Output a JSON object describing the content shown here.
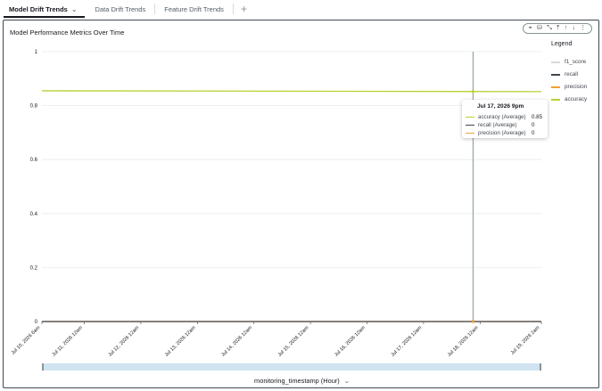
{
  "tabs": [
    {
      "label": "Model Drift Trends",
      "active": true
    },
    {
      "label": "Data Drift Trends",
      "active": false
    },
    {
      "label": "Feature Drift Trends",
      "active": false
    }
  ],
  "tab_add_label": "+",
  "visual": {
    "title": "Model Performance Metrics Over Time",
    "toolbar_icons": [
      "focus-icon",
      "drill-icon",
      "collapse-icon",
      "sort-top-icon",
      "sort-up-icon",
      "sort-down-icon",
      "more-icon"
    ],
    "toolbar_glyphs": [
      "⌖",
      "⛁",
      "⤡",
      "⤒",
      "↑",
      "↓",
      "⋮"
    ],
    "x_field_label": "monitoring_timestamp (Hour)"
  },
  "legend": {
    "title": "Legend",
    "items": [
      {
        "label": "f1_score",
        "color": "#d5dbdb"
      },
      {
        "label": "recall",
        "color": "#414750"
      },
      {
        "label": "precision",
        "color": "#f0a037"
      },
      {
        "label": "accuracy",
        "color": "#b7d132"
      }
    ]
  },
  "tooltip": {
    "header": "Jul 17, 2026 9pm",
    "rows": [
      {
        "name": "accuracy (Average)",
        "value": "0.85",
        "color": "#b7d132"
      },
      {
        "name": "recall (Average)",
        "value": "0",
        "color": "#414750"
      },
      {
        "name": "precision (Average)",
        "value": "0",
        "color": "#f0a037"
      }
    ]
  },
  "chart_data": {
    "type": "line",
    "title": "Model Performance Metrics Over Time",
    "xlabel": "monitoring_timestamp (Hour)",
    "ylabel": "",
    "ylim": [
      0,
      1
    ],
    "y_ticks": [
      "0",
      "0.2",
      "0.4",
      "0.6",
      "0.8",
      "1"
    ],
    "y_tick_values": [
      0,
      0.2,
      0.4,
      0.6,
      0.8,
      1
    ],
    "x_ticks": [
      "Jul 10, 2026 6am",
      "Jul 11, 2026 12am",
      "Jul 12, 2026 12am",
      "Jul 13, 2026 12am",
      "Jul 14, 2026 12am",
      "Jul 15, 2026 12am",
      "Jul 16, 2026 12am",
      "Jul 17, 2026 12am",
      "Jul 18, 2026 12am",
      "Jul 19, 2026 2am"
    ],
    "x_tick_hours": [
      6,
      24,
      48,
      72,
      96,
      120,
      144,
      168,
      192,
      218
    ],
    "x_range_hours": [
      6,
      218
    ],
    "hover_hour": 189,
    "grid": true,
    "legend_position": "right",
    "series": [
      {
        "name": "accuracy",
        "color": "#b7d132",
        "x_hours": [
          6,
          218
        ],
        "values": [
          0.855,
          0.852
        ]
      },
      {
        "name": "recall",
        "color": "#414750",
        "x_hours": [
          6,
          218
        ],
        "values": [
          0,
          0
        ]
      },
      {
        "name": "precision",
        "color": "#f0a037",
        "x_hours": [
          6,
          218
        ],
        "values": [
          0,
          0
        ]
      },
      {
        "name": "f1_score",
        "color": "#d5dbdb",
        "x_hours": [
          6,
          218
        ],
        "values": [
          0,
          0
        ]
      }
    ]
  }
}
